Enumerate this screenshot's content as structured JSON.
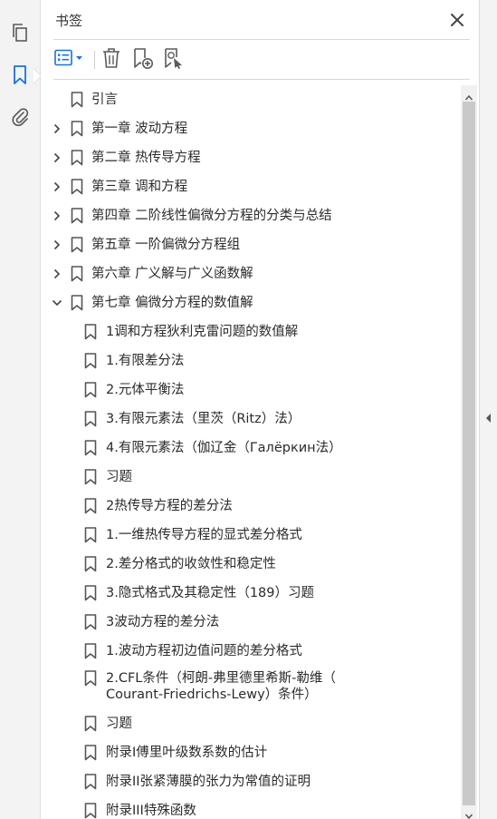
{
  "panel": {
    "title": "书签"
  },
  "rail": {
    "icons": [
      "pages-icon",
      "bookmark-icon",
      "attachment-icon"
    ]
  },
  "toolbar": {
    "icons": [
      "options-icon",
      "delete-icon",
      "new-bookmark-icon",
      "bookmark-from-selection-icon"
    ]
  },
  "bookmarks": [
    {
      "level": 0,
      "expander": "none",
      "label": "引言"
    },
    {
      "level": 0,
      "expander": "collapsed",
      "label": "第一章  波动方程"
    },
    {
      "level": 0,
      "expander": "collapsed",
      "label": "第二章  热传导方程"
    },
    {
      "level": 0,
      "expander": "collapsed",
      "label": "第三章  调和方程"
    },
    {
      "level": 0,
      "expander": "collapsed",
      "label": "第四章  二阶线性偏微分方程的分类与总结"
    },
    {
      "level": 0,
      "expander": "collapsed",
      "label": "第五章  一阶偏微分方程组"
    },
    {
      "level": 0,
      "expander": "collapsed",
      "label": "第六章  广义解与广义函数解"
    },
    {
      "level": 0,
      "expander": "expanded",
      "label": "第七章  偏微分方程的数值解"
    },
    {
      "level": 1,
      "expander": "none",
      "label": "1调和方程狄利克雷问题的数值解"
    },
    {
      "level": 1,
      "expander": "none",
      "label": "1.有限差分法"
    },
    {
      "level": 1,
      "expander": "none",
      "label": "2.元体平衡法"
    },
    {
      "level": 1,
      "expander": "none",
      "label": "3.有限元素法（里茨（Ritz）法）"
    },
    {
      "level": 1,
      "expander": "none",
      "label": "4.有限元素法（伽辽金（Галёркин法）"
    },
    {
      "level": 1,
      "expander": "none",
      "label": "习题"
    },
    {
      "level": 1,
      "expander": "none",
      "label": "2热传导方程的差分法"
    },
    {
      "level": 1,
      "expander": "none",
      "label": "1.一维热传导方程的显式差分格式"
    },
    {
      "level": 1,
      "expander": "none",
      "label": "2.差分格式的收敛性和稳定性"
    },
    {
      "level": 1,
      "expander": "none",
      "label": "3.隐式格式及其稳定性（189）习题"
    },
    {
      "level": 1,
      "expander": "none",
      "label": "3波动方程的差分法"
    },
    {
      "level": 1,
      "expander": "none",
      "label": "1.波动方程初边值问题的差分格式"
    },
    {
      "level": 1,
      "expander": "none",
      "label": "2.CFL条件（柯朗-弗里德里希斯-勒维（ Courant-Friedrichs-Lewy）条件）",
      "wrap": true
    },
    {
      "level": 1,
      "expander": "none",
      "label": "习题"
    },
    {
      "level": 1,
      "expander": "none",
      "label": "附录I傅里叶级数系数的估计"
    },
    {
      "level": 1,
      "expander": "none",
      "label": "附录II张紧薄膜的张力为常值的证明"
    },
    {
      "level": 1,
      "expander": "none",
      "label": "附录III特殊函数"
    }
  ],
  "scrollbar": {
    "position": 0.0,
    "visible_fraction": 0.96
  },
  "colors": {
    "icon": "#5a5a5a",
    "accent": "#1473e6",
    "thumb": "#c9c9c9"
  }
}
